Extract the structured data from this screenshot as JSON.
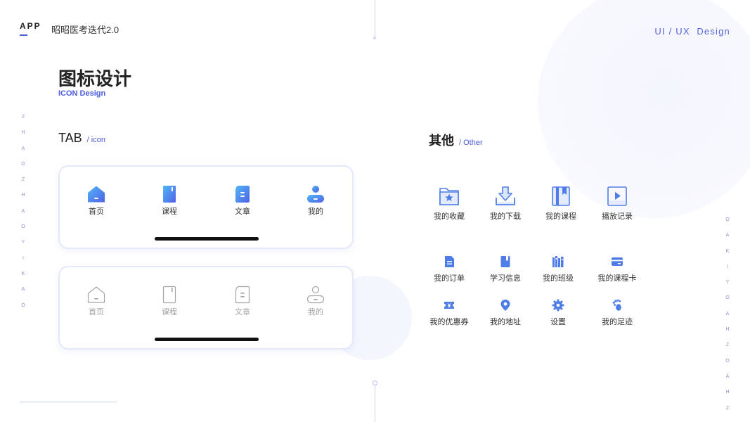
{
  "header": {
    "brand": "APP",
    "app_name": "昭昭医考迭代2.0",
    "ux_label": "UI / UX  Design"
  },
  "page": {
    "title": "图标设计",
    "subtitle": "ICON Design"
  },
  "side_text": {
    "left": [
      "Z",
      "H",
      "A",
      "O",
      "Z",
      "H",
      "A",
      "O",
      "Y",
      "I",
      "K",
      "A",
      "O"
    ],
    "right": [
      "O",
      "A",
      "K",
      "I",
      "Y",
      "O",
      "A",
      "H",
      "Z",
      "O",
      "A",
      "H",
      "Z"
    ]
  },
  "tab_section": {
    "title": "TAB",
    "subtitle": "/ icon",
    "active_tabs": [
      {
        "label": "首页",
        "icon": "home-icon"
      },
      {
        "label": "课程",
        "icon": "book-icon"
      },
      {
        "label": "文章",
        "icon": "article-icon"
      },
      {
        "label": "我的",
        "icon": "user-icon"
      }
    ],
    "inactive_tabs": [
      {
        "label": "首页",
        "icon": "home-icon"
      },
      {
        "label": "课程",
        "icon": "book-icon"
      },
      {
        "label": "文章",
        "icon": "article-icon"
      },
      {
        "label": "我的",
        "icon": "user-icon"
      }
    ]
  },
  "other_section": {
    "title": "其他",
    "subtitle": "/ Other",
    "large_icons": [
      {
        "label": "我的收藏",
        "icon": "favorites-folder-icon"
      },
      {
        "label": "我的下载",
        "icon": "download-icon"
      },
      {
        "label": "我的课程",
        "icon": "course-book-icon"
      },
      {
        "label": "播放记录",
        "icon": "play-history-icon"
      }
    ],
    "small_icons": [
      {
        "label": "我的订单",
        "icon": "order-icon"
      },
      {
        "label": "学习信息",
        "icon": "study-info-icon"
      },
      {
        "label": "我的班级",
        "icon": "class-icon"
      },
      {
        "label": "我的课程卡",
        "icon": "course-card-icon"
      },
      {
        "label": "我的优惠券",
        "icon": "coupon-icon"
      },
      {
        "label": "我的地址",
        "icon": "location-icon"
      },
      {
        "label": "设置",
        "icon": "settings-icon"
      },
      {
        "label": "我的足迹",
        "icon": "footprint-icon"
      }
    ]
  },
  "colors": {
    "accent": "#4b5be0",
    "icon_blue": "#4f7de8",
    "gradient_light": "#4fb7f7",
    "gradient_dark": "#5062e5",
    "inactive_gray": "#a3a3a3"
  }
}
